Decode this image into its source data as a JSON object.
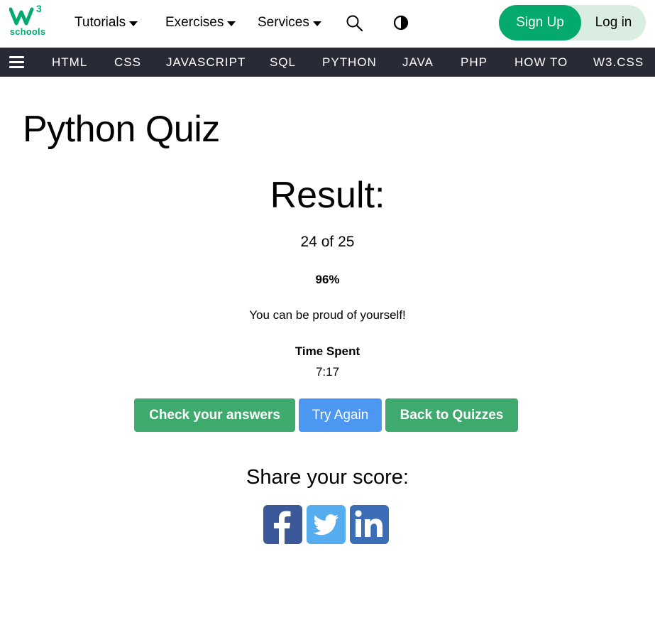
{
  "header": {
    "logo": {
      "mark": "W",
      "superscript": "3",
      "text": "schools"
    },
    "menus": [
      {
        "label": "Tutorials"
      },
      {
        "label": "Exercises"
      },
      {
        "label": "Services"
      }
    ],
    "search_icon": "search-icon",
    "theme_icon": "contrast-icon",
    "signup_label": "Sign Up",
    "login_label": "Log in"
  },
  "topnav": {
    "menu_icon": "hamburger-icon",
    "items": [
      "HTML",
      "CSS",
      "JAVASCRIPT",
      "SQL",
      "PYTHON",
      "JAVA",
      "PHP",
      "HOW TO",
      "W3.CSS"
    ]
  },
  "main": {
    "page_title": "Python Quiz",
    "result_title": "Result:",
    "score": "24 of 25",
    "percent": "96%",
    "message": "You can be proud of yourself!",
    "time_label": "Time Spent",
    "time_value": "7:17",
    "buttons": {
      "check": "Check your answers",
      "retry": "Try Again",
      "back": "Back to Quizzes"
    },
    "share_title": "Share your score:",
    "share_icons": [
      "facebook-icon",
      "twitter-icon",
      "linkedin-icon"
    ]
  },
  "colors": {
    "brand_green": "#04AA6D",
    "button_green": "#3EAA6D",
    "button_blue": "#4C97F2",
    "nav_dark": "#282A35",
    "facebook": "#3B5998",
    "twitter": "#55ACEE",
    "linkedin": "#3C6EB8"
  }
}
